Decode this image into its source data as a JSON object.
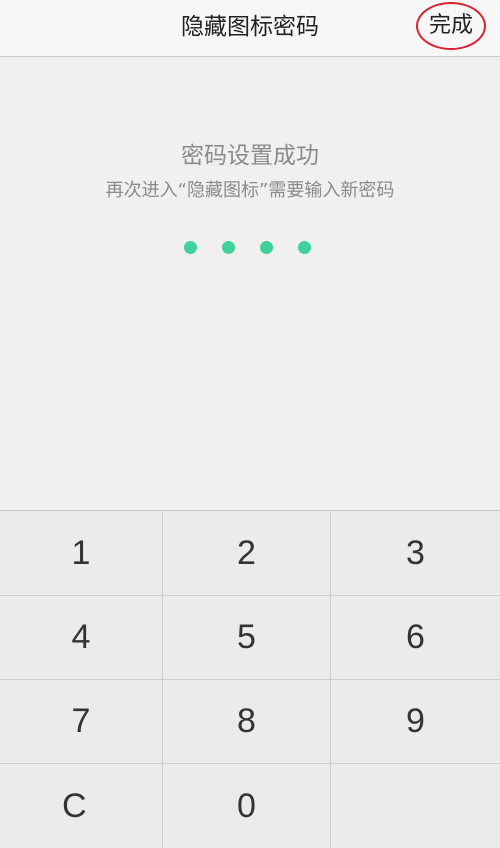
{
  "header": {
    "title": "隐藏图标密码",
    "done_label": "完成"
  },
  "status": {
    "title": "密码设置成功",
    "subtitle": "再次进入“隐藏图标”需要输入新密码"
  },
  "passcode": {
    "entered_count": 4,
    "dot_color": "#3ed19a"
  },
  "keypad": {
    "keys": [
      "1",
      "2",
      "3",
      "4",
      "5",
      "6",
      "7",
      "8",
      "9",
      "C",
      "0",
      ""
    ]
  },
  "colors": {
    "highlight_circle": "#d9232e"
  }
}
